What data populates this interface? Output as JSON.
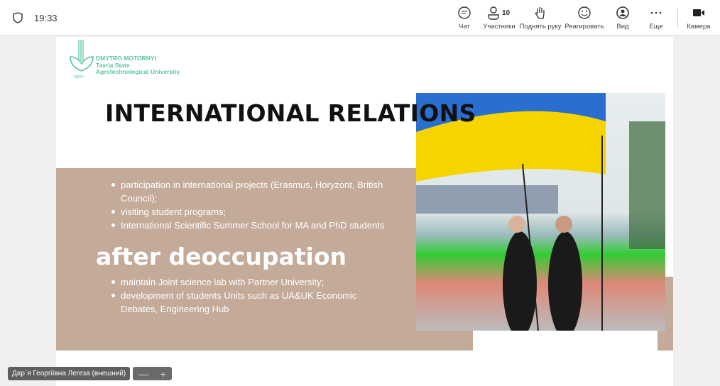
{
  "topbar": {
    "time": "19:33",
    "buttons": [
      {
        "label": "Чат",
        "icon": "chat-icon"
      },
      {
        "label": "Участники",
        "icon": "people-icon",
        "count": "10"
      },
      {
        "label": "Поднять руку",
        "icon": "hand-icon"
      },
      {
        "label": "Реагировать",
        "icon": "smile-icon"
      },
      {
        "label": "Вид",
        "icon": "view-icon"
      },
      {
        "label": "Еще",
        "icon": "more-icon"
      },
      {
        "label": "Камера",
        "icon": "camera-icon"
      }
    ]
  },
  "slide": {
    "logo": {
      "line1": "DMYTRO MOTORNYI",
      "line2": "Tavria State",
      "line3": "Agrotechnological University",
      "abbr": "ТДАТУ"
    },
    "title": "INTERNATIONAL RELATIONS",
    "bullets1": [
      "participation in international projects (Erasmus, Horyzont, British Council);",
      "visiting student programs;",
      "International Scientific Summer School for MA and PhD students"
    ],
    "subtitle": "after deoccupation",
    "bullets2": [
      "maintain Joint science lab with Partner University;",
      "development of students Units such as UA&UK Economic Debates, Engineering Hub"
    ]
  },
  "footer": {
    "participant": "Дар`я Георгіївна Легеза (внешний)",
    "zoom_out": "—",
    "zoom_in": "+"
  },
  "colors": {
    "band": "#c4aa98",
    "logo": "#5cc3a4",
    "flag_blue": "#2a6fd0",
    "flag_yellow": "#f5d400"
  }
}
